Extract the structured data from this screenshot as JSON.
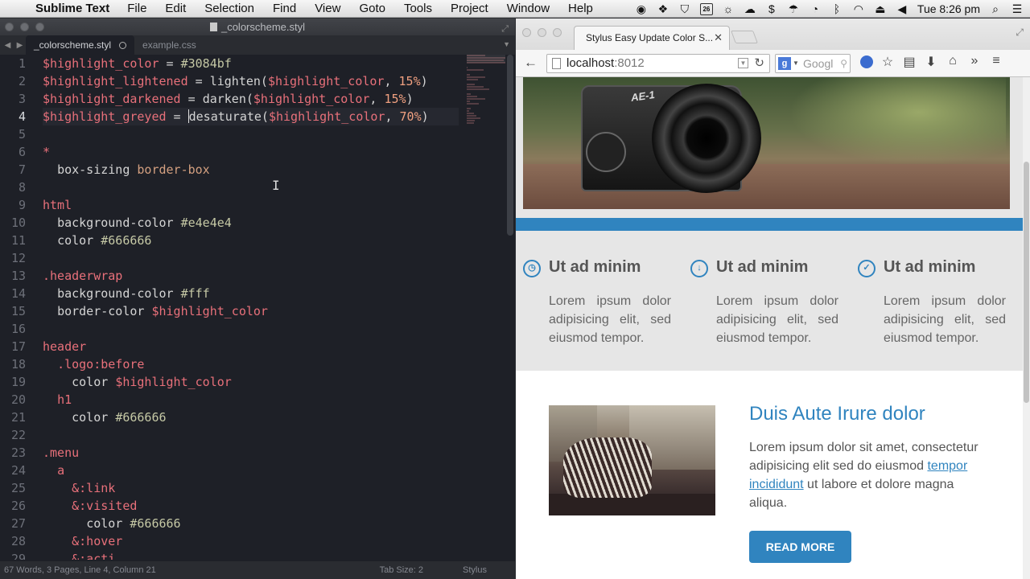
{
  "menubar": {
    "app_name": "Sublime Text",
    "items": [
      "File",
      "Edit",
      "Selection",
      "Find",
      "View",
      "Goto",
      "Tools",
      "Project",
      "Window",
      "Help"
    ],
    "calendar_day": "26",
    "clock": "Tue 8:26 pm"
  },
  "editor": {
    "window_title": "_colorscheme.styl",
    "tabs": [
      {
        "label": "_colorscheme.styl",
        "active": true,
        "dirty": true
      },
      {
        "label": "example.css",
        "active": false
      }
    ],
    "current_line": 4,
    "lines": [
      [
        [
          "var",
          "$highlight_color"
        ],
        [
          "op",
          " = "
        ],
        [
          "hex",
          "#3084bf"
        ]
      ],
      [
        [
          "var",
          "$highlight_lightened"
        ],
        [
          "op",
          " = "
        ],
        [
          "fn",
          "lighten("
        ],
        [
          "var",
          "$highlight_color"
        ],
        [
          "op",
          ", "
        ],
        [
          "num",
          "15%"
        ],
        [
          "op",
          ")"
        ]
      ],
      [
        [
          "var",
          "$highlight_darkened"
        ],
        [
          "op",
          " = "
        ],
        [
          "fn",
          "darken("
        ],
        [
          "var",
          "$highlight_color"
        ],
        [
          "op",
          ", "
        ],
        [
          "num",
          "15%"
        ],
        [
          "op",
          ")"
        ]
      ],
      [
        [
          "var",
          "$highlight_greyed"
        ],
        [
          "op",
          " = "
        ],
        [
          "caret",
          ""
        ],
        [
          "fn",
          "desaturate("
        ],
        [
          "var",
          "$highlight_color"
        ],
        [
          "op",
          ", "
        ],
        [
          "num",
          "70%"
        ],
        [
          "op",
          ")"
        ]
      ],
      [],
      [
        [
          "sel",
          "*"
        ]
      ],
      [
        [
          "op",
          "  "
        ],
        [
          "prop",
          "box-sizing "
        ],
        [
          "val",
          "border-box"
        ]
      ],
      [],
      [
        [
          "sel",
          "html"
        ]
      ],
      [
        [
          "op",
          "  "
        ],
        [
          "prop",
          "background-color "
        ],
        [
          "hex",
          "#e4e4e4"
        ]
      ],
      [
        [
          "op",
          "  "
        ],
        [
          "prop",
          "color "
        ],
        [
          "hex",
          "#666666"
        ]
      ],
      [],
      [
        [
          "sel",
          ".headerwrap"
        ]
      ],
      [
        [
          "op",
          "  "
        ],
        [
          "prop",
          "background-color "
        ],
        [
          "hex",
          "#fff"
        ]
      ],
      [
        [
          "op",
          "  "
        ],
        [
          "prop",
          "border-color "
        ],
        [
          "var",
          "$highlight_color"
        ]
      ],
      [],
      [
        [
          "sel",
          "header"
        ]
      ],
      [
        [
          "op",
          "  "
        ],
        [
          "sel",
          ".logo:before"
        ]
      ],
      [
        [
          "op",
          "    "
        ],
        [
          "prop",
          "color "
        ],
        [
          "var",
          "$highlight_color"
        ]
      ],
      [
        [
          "op",
          "  "
        ],
        [
          "sel",
          "h1"
        ]
      ],
      [
        [
          "op",
          "    "
        ],
        [
          "prop",
          "color "
        ],
        [
          "hex",
          "#666666"
        ]
      ],
      [],
      [
        [
          "sel",
          ".menu"
        ]
      ],
      [
        [
          "op",
          "  "
        ],
        [
          "sel",
          "a"
        ]
      ],
      [
        [
          "op",
          "    "
        ],
        [
          "sel",
          "&:link"
        ]
      ],
      [
        [
          "op",
          "    "
        ],
        [
          "sel",
          "&:visited"
        ]
      ],
      [
        [
          "op",
          "      "
        ],
        [
          "prop",
          "color "
        ],
        [
          "hex",
          "#666666"
        ]
      ],
      [
        [
          "op",
          "    "
        ],
        [
          "sel",
          "&:hover"
        ]
      ],
      [
        [
          "op",
          "    "
        ],
        [
          "sel",
          "&:acti"
        ]
      ]
    ],
    "status": {
      "left": "67 Words, 3 Pages, Line 4, Column 21",
      "tab_size": "Tab Size: 2",
      "syntax": "Stylus"
    }
  },
  "browser": {
    "tab_title": "Stylus Easy Update Color S...",
    "url_host": "localhost",
    "url_port": ":8012",
    "search_placeholder": "Googl",
    "accent_color": "#3084bf",
    "features": [
      {
        "title": "Ut ad minim",
        "text": "Lorem ipsum dolor adipisicing elit, sed eiusmod tempor.",
        "icon": "clock-icon",
        "glyph": "◷"
      },
      {
        "title": "Ut ad minim",
        "text": "Lorem ipsum dolor adipisicing elit, sed eiusmod tempor.",
        "icon": "download-icon",
        "glyph": "↓"
      },
      {
        "title": "Ut ad minim",
        "text": "Lorem ipsum dolor adipisicing elit, sed eiusmod tempor.",
        "icon": "check-icon",
        "glyph": "✓"
      }
    ],
    "hero_camera_brand": "AE-1",
    "article": {
      "heading": "Duis Aute Irure dolor",
      "text_before": "Lorem ipsum dolor sit amet, consectetur adipisicing elit sed do eiusmod ",
      "link": "tempor incididunt",
      "text_after": " ut labore et dolore magna aliqua.",
      "button": "READ MORE"
    }
  }
}
